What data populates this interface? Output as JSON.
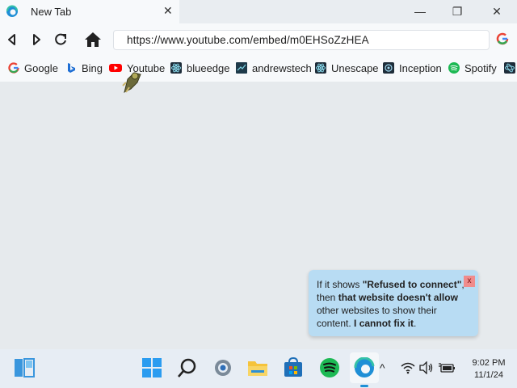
{
  "tab": {
    "title": "New Tab",
    "close": "✕"
  },
  "window": {
    "minimize": "—",
    "restore": "❐",
    "close": "✕"
  },
  "address": {
    "url": "https://www.youtube.com/embed/m0EHSoZzHEA"
  },
  "bookmarks": [
    {
      "label": "Google",
      "icon": "google-icon",
      "color": "#4285f4"
    },
    {
      "label": "Bing",
      "icon": "bing-icon",
      "color": "#1f6fd4"
    },
    {
      "label": "Youtube",
      "icon": "youtube-icon",
      "color": "#ff0000"
    },
    {
      "label": "blueedge",
      "icon": "react-icon",
      "color": "#1e2d3a"
    },
    {
      "label": "andrewstech",
      "icon": "andrewstech-icon",
      "color": "#1e3a4a"
    },
    {
      "label": "Unescape",
      "icon": "react-icon",
      "color": "#1e2d3a"
    },
    {
      "label": "Inception",
      "icon": "inception-icon",
      "color": "#1e2d3a"
    },
    {
      "label": "Spotify",
      "icon": "spotify-icon",
      "color": "#1db954"
    }
  ],
  "popup": {
    "t1": "If it shows ",
    "t2": "\"Refused to connect\"",
    "t3": ", then ",
    "t4": "that website doesn't allow",
    "t5": " other websites to show their content. ",
    "t6": "I cannot fix it",
    "t7": ".",
    "close": "x"
  },
  "clock": {
    "time": "9:02 PM",
    "date": "11/1/24"
  }
}
